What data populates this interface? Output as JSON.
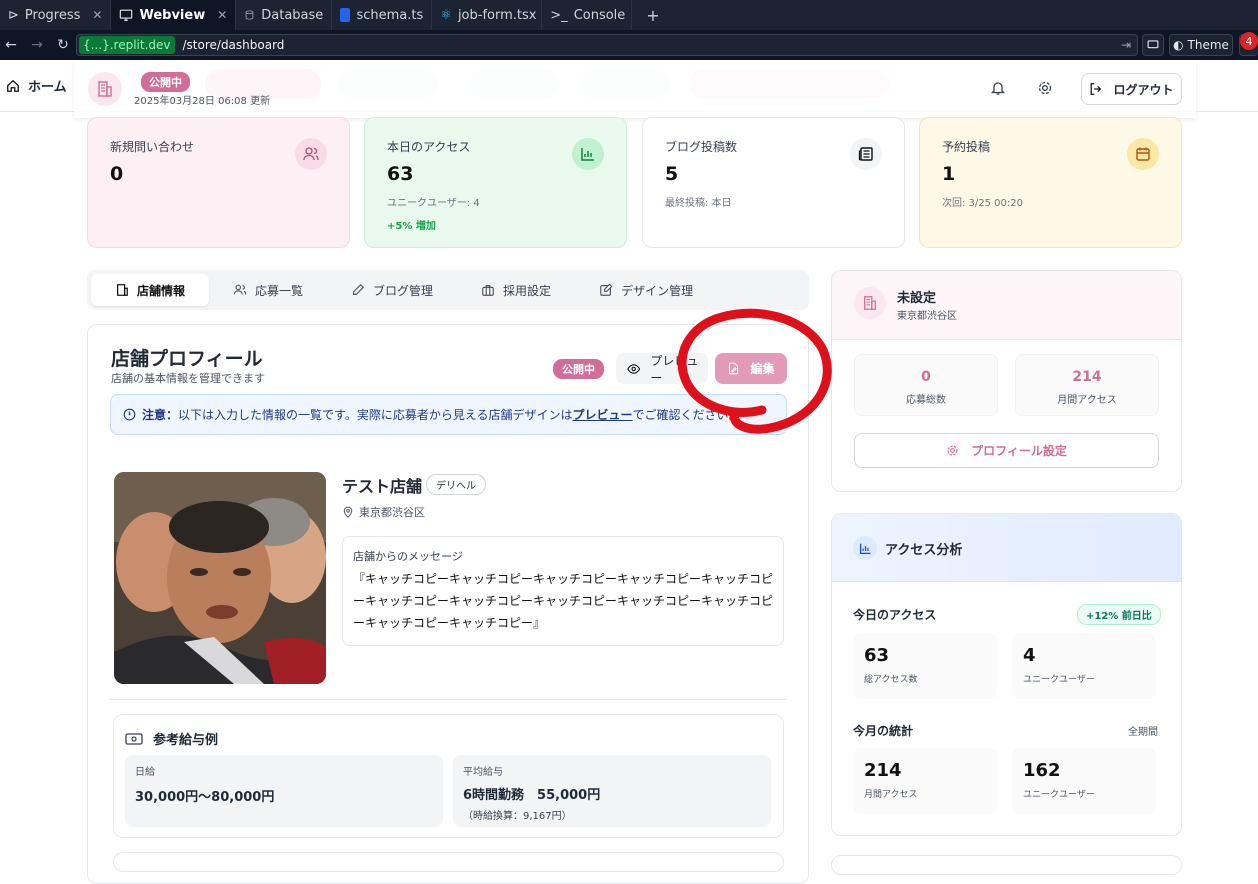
{
  "browser": {
    "tabs": [
      {
        "label": "Progress",
        "icon": "progress-icon",
        "closable": true
      },
      {
        "label": "Webview",
        "icon": "monitor-icon",
        "closable": true,
        "active": true
      },
      {
        "label": "Database",
        "icon": "database-icon",
        "closable": false
      },
      {
        "label": "schema.ts",
        "icon": "typescript-icon",
        "closable": false
      },
      {
        "label": "job-form.tsx",
        "icon": "react-icon",
        "closable": false
      },
      {
        "label": "Console",
        "icon": "terminal-icon",
        "closable": false
      }
    ],
    "url_domain": "{...}.replit.dev",
    "url_path": "/store/dashboard",
    "theme_label": "Theme",
    "notification_count": "4"
  },
  "header": {
    "home_label": "ホーム",
    "status_badge": "公開中",
    "updated": "2025年03月28日 06:08 更新",
    "logout_label": "ログアウト"
  },
  "stats": [
    {
      "label": "新規問い合わせ",
      "value": "0",
      "icon": "users-icon",
      "bg": "#fdf0f5",
      "icon_bg": "#f7dce7"
    },
    {
      "label": "本日のアクセス",
      "value": "63",
      "sub": "ユニークユーザー: 4",
      "trend": "+5% 増加",
      "icon": "bar-chart-icon",
      "bg": "#e9f9ee",
      "icon_bg": "#bff0cf"
    },
    {
      "label": "ブログ投稿数",
      "value": "5",
      "sub": "最終投稿: 本日",
      "icon": "newspaper-icon",
      "bg": "#ffffff",
      "icon_bg": "#f3f4f6"
    },
    {
      "label": "予約投稿",
      "value": "1",
      "sub": "次回: 3/25 00:20",
      "icon": "calendar-icon",
      "bg": "#fef9e7",
      "icon_bg": "#fbe7a6"
    }
  ],
  "tabs": [
    {
      "label": "店舗情報",
      "icon": "store-icon",
      "active": true
    },
    {
      "label": "応募一覧",
      "icon": "users-icon"
    },
    {
      "label": "ブログ管理",
      "icon": "pen-icon"
    },
    {
      "label": "採用設定",
      "icon": "briefcase-icon"
    },
    {
      "label": "デザイン管理",
      "icon": "edit-icon"
    }
  ],
  "profile": {
    "title": "店舗プロフィール",
    "subtitle": "店舗の基本情報を管理できます",
    "status_badge": "公開中",
    "preview_label": "プレビュー",
    "edit_label": "編集",
    "notice_bold": "注意：",
    "notice_text": "以下は入力した情報の一覧です。実際に応募者から見える店舗デザインは",
    "notice_link": "プレビュー",
    "notice_tail": "でご確認ください。",
    "store_name": "テスト店舗",
    "store_type": "デリヘル",
    "location": "東京都渋谷区",
    "message_heading": "店舗からのメッセージ",
    "message_text": "『キャッチコピーキャッチコピーキャッチコピーキャッチコピーキャッチコピーキャッチコピーキャッチコピーキャッチコピーキャッチコピーキャッチコピーキャッチコピーキャッチコピー』"
  },
  "salary": {
    "heading": "参考給与例",
    "daily_label": "日給",
    "daily_value": "30,000円〜80,000円",
    "avg_label": "平均給与",
    "avg_value": "6時間勤務　55,000円",
    "avg_note": "（時給換算：9,167円）"
  },
  "side_store": {
    "name": "未設定",
    "location": "東京都渋谷区",
    "applications_value": "0",
    "applications_label": "応募総数",
    "monthly_value": "214",
    "monthly_label": "月間アクセス",
    "settings_label": "プロフィール設定"
  },
  "analytics": {
    "title": "アクセス分析",
    "today_heading": "今日のアクセス",
    "growth": "+12% 前日比",
    "today": [
      {
        "value": "63",
        "label": "総アクセス数"
      },
      {
        "value": "4",
        "label": "ユニークユーザー"
      }
    ],
    "month_heading": "今月の統計",
    "month_period": "全期間",
    "month": [
      {
        "value": "214",
        "label": "月間アクセス"
      },
      {
        "value": "162",
        "label": "ユニークユーザー"
      }
    ]
  },
  "colors": {
    "brand_pink": "#d16d97",
    "annotation_red": "#e0101a"
  }
}
